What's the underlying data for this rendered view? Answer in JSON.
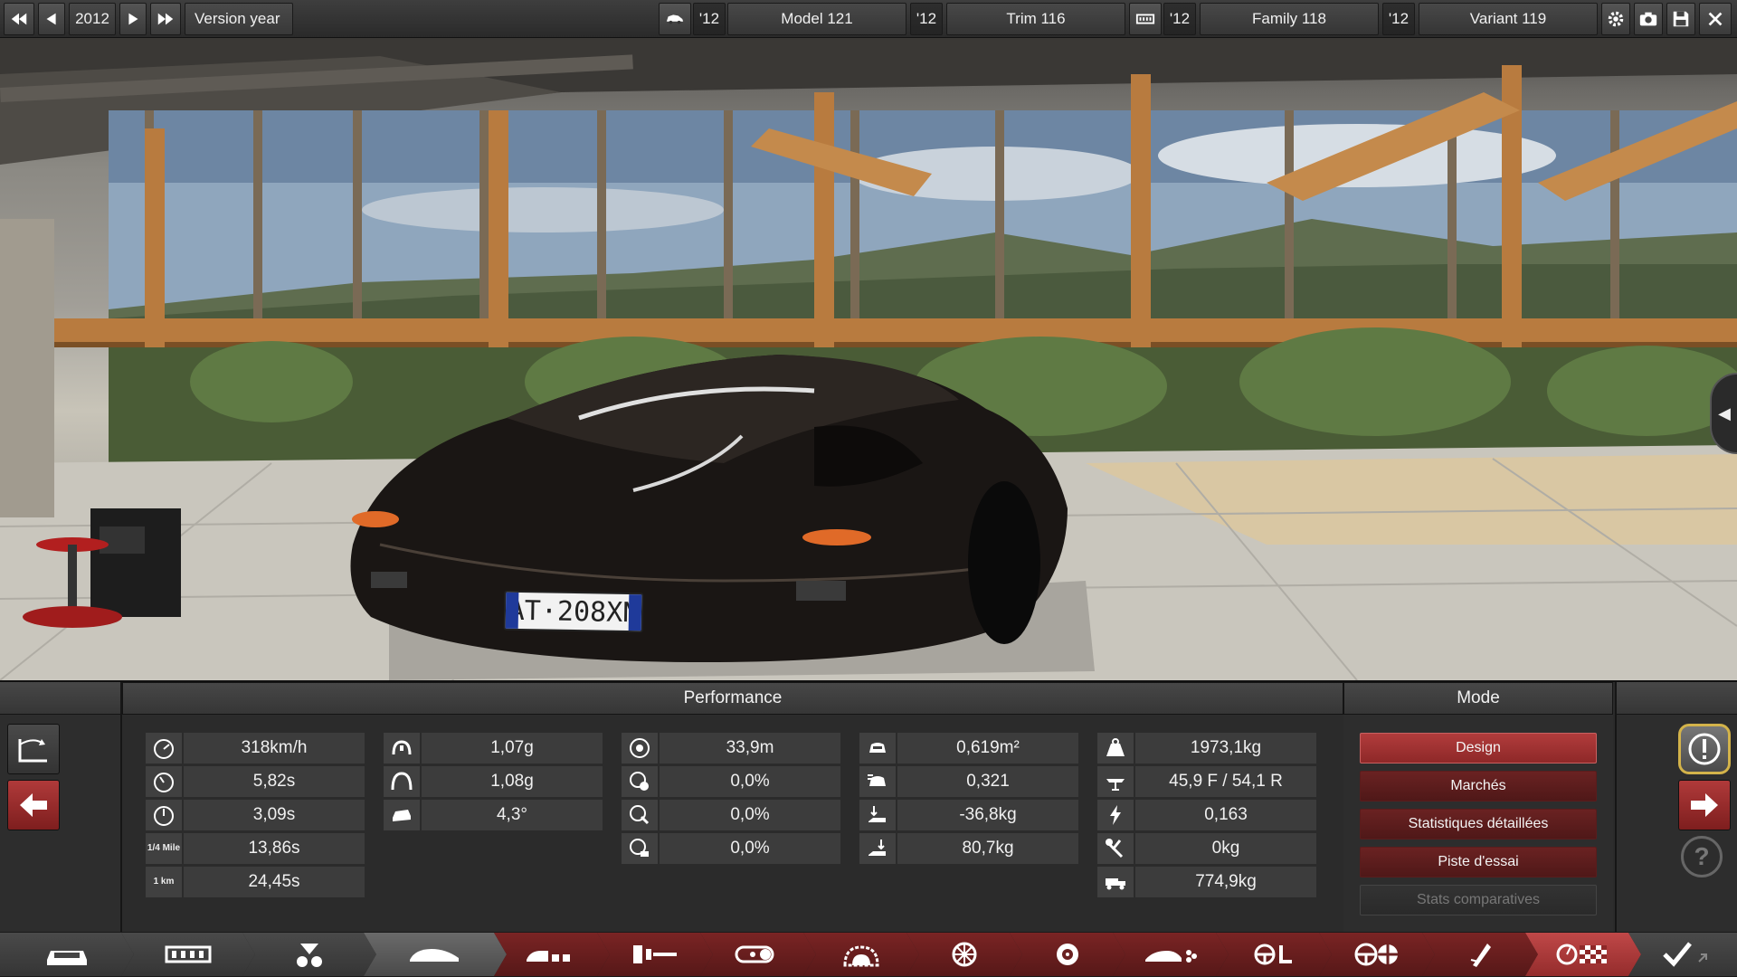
{
  "topbar": {
    "year": "2012",
    "version_label": "Version year",
    "model_year": "'12",
    "model": "Model 121",
    "trim_year": "'12",
    "trim": "Trim 116",
    "family_year": "'12",
    "family": "Family 118",
    "variant_year": "'12",
    "variant": "Variant 119"
  },
  "scene": {
    "license_plate": "AT·208XN"
  },
  "performance": {
    "title": "Performance",
    "col1": [
      {
        "icon": "top-speed-gauge-icon",
        "value": "318km/h"
      },
      {
        "icon": "acceleration-0-100-icon",
        "value": "5,82s"
      },
      {
        "icon": "acceleration-0-60-icon",
        "value": "3,09s"
      },
      {
        "icon": "quarter-mile-icon",
        "icon_text": "1/4 Mile",
        "value": "13,86s"
      },
      {
        "icon": "one-km-icon",
        "icon_text": "1 km",
        "value": "24,45s"
      }
    ],
    "col2": [
      {
        "icon": "cornering-low-speed-icon",
        "value": "1,07g"
      },
      {
        "icon": "cornering-high-speed-icon",
        "value": "1,08g"
      },
      {
        "icon": "body-roll-icon",
        "value": "4,3°"
      }
    ],
    "col3": [
      {
        "icon": "braking-distance-icon",
        "value": "33,9m"
      },
      {
        "icon": "brake-fade-icon",
        "value": "0,0%"
      },
      {
        "icon": "brake-cooling-icon",
        "value": "0,0%"
      },
      {
        "icon": "brake-temp-icon",
        "value": "0,0%"
      }
    ],
    "col4": [
      {
        "icon": "frontal-area-icon",
        "value": "0,619m²"
      },
      {
        "icon": "drag-coefficient-icon",
        "value": "0,321"
      },
      {
        "icon": "front-downforce-icon",
        "value": "-36,8kg"
      },
      {
        "icon": "rear-downforce-icon",
        "value": "80,7kg"
      }
    ],
    "col5": [
      {
        "icon": "weight-icon",
        "value": "1973,1kg"
      },
      {
        "icon": "weight-distribution-icon",
        "value": "45,9 F / 54,1 R"
      },
      {
        "icon": "power-to-weight-icon",
        "value": "0,163"
      },
      {
        "icon": "tools-icon",
        "value": "0kg"
      },
      {
        "icon": "towing-icon",
        "value": "774,9kg"
      }
    ]
  },
  "mode": {
    "title": "Mode",
    "buttons": [
      {
        "label": "Design",
        "state": "active"
      },
      {
        "label": "Marchés",
        "state": "normal"
      },
      {
        "label": "Statistiques détaillées",
        "state": "normal"
      },
      {
        "label": "Piste d'essai",
        "state": "normal"
      },
      {
        "label": "Stats comparatives",
        "state": "disabled"
      }
    ]
  },
  "help": {
    "symbol": "?"
  },
  "colors": {
    "accent_red": "#b13c3c",
    "dark_red": "#561818",
    "panel_bg": "#2b2b2b",
    "warning_gold": "#d3b34a"
  }
}
